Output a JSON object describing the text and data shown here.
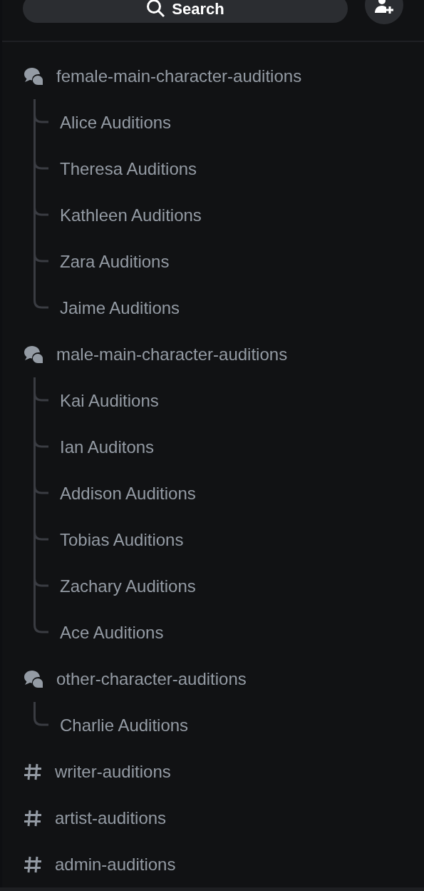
{
  "search": {
    "label": "Search"
  },
  "channels": [
    {
      "kind": "forum",
      "name": "female-main-character-auditions",
      "threads": [
        "Alice Auditions",
        "Theresa Auditions",
        "Kathleen Auditions",
        "Zara Auditions",
        "Jaime Auditions"
      ]
    },
    {
      "kind": "forum",
      "name": "male-main-character-auditions",
      "threads": [
        "Kai Auditions",
        "Ian Auditons",
        "Addison Auditions",
        "Tobias Auditions",
        "Zachary Auditions",
        "Ace Auditions"
      ]
    },
    {
      "kind": "forum",
      "name": "other-character-auditions",
      "threads": [
        "Charlie Auditions"
      ]
    },
    {
      "kind": "text",
      "name": "writer-auditions"
    },
    {
      "kind": "text",
      "name": "artist-auditions"
    },
    {
      "kind": "text",
      "name": "admin-auditions"
    }
  ]
}
